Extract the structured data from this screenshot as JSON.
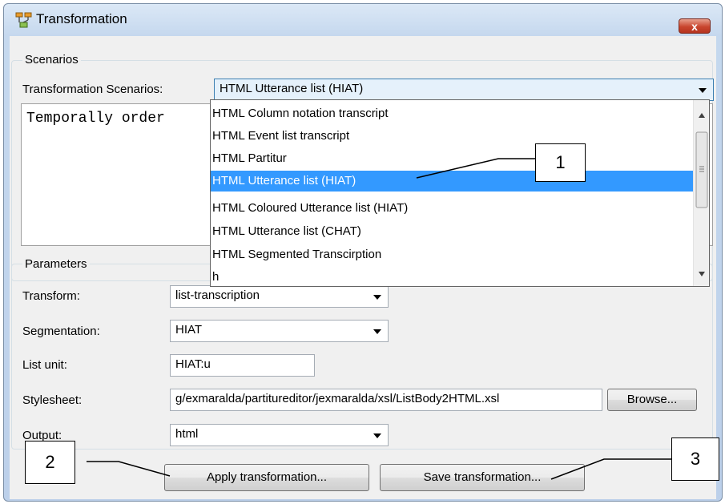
{
  "window": {
    "title": "Transformation",
    "close_label": "x"
  },
  "scenarios": {
    "legend": "Scenarios",
    "label": "Transformation Scenarios:",
    "selected": "HTML Utterance list (HIAT)",
    "description": "Temporally order"
  },
  "dropdown": {
    "items": [
      "HTML Column notation transcript",
      "HTML Event list transcript",
      "HTML Partitur",
      "HTML Utterance list (HIAT)",
      "HTML Coloured Utterance list (HIAT)",
      "HTML Utterance list (CHAT)",
      "HTML Segmented Transcirption",
      "h"
    ],
    "selected_index": 3
  },
  "parameters": {
    "legend": "Parameters",
    "transform_label": "Transform:",
    "transform_value": "list-transcription",
    "segmentation_label": "Segmentation:",
    "segmentation_value": "HIAT",
    "list_unit_label": "List unit:",
    "list_unit_value": "HIAT:u",
    "stylesheet_label": "Stylesheet:",
    "stylesheet_value": "g/exmaralda/partitureditor/jexmaralda/xsl/ListBody2HTML.xsl",
    "browse_label": "Browse...",
    "output_label": "Output:",
    "output_value": "html"
  },
  "actions": {
    "apply_label": "Apply transformation...",
    "save_label": "Save transformation..."
  },
  "callouts": [
    "1",
    "2",
    "3"
  ],
  "colors": {
    "selection": "#3399ff",
    "window_frame": "#bcd0ea",
    "panel": "#f0f0f0"
  }
}
